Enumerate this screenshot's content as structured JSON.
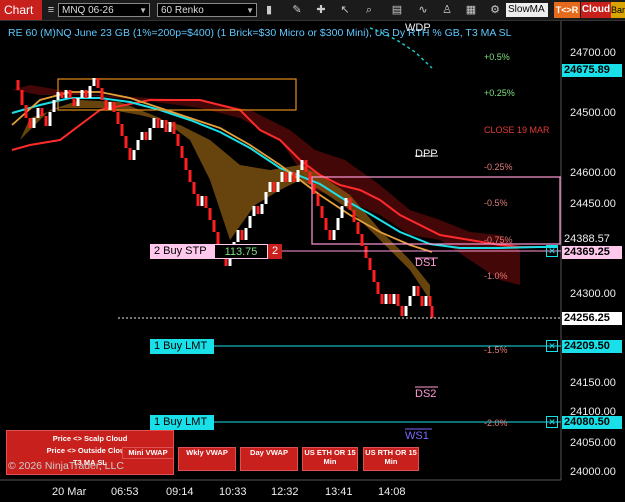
{
  "toolbar": {
    "chart_label": "Chart",
    "instrument": "MNQ 06-26",
    "bar_type": "60 Renko",
    "indicator_select": "SlowMA",
    "tcr_button": "T<>R",
    "cloud_button": "Cloud",
    "bar_button": "Bar"
  },
  "chart": {
    "title": "RE 60 (M)NQ June 23 GB (1%=200p=$400) (1 Brick=$30 Micro or $300 Mini), US Dy RTH % GB, T3 MA SL",
    "wdp_label": "WDP",
    "dpp_label": "DPP",
    "ds1_label": "DS1",
    "ds2_label": "DS2",
    "ws1_label": "WS1",
    "close_label": "CLOSE 19 MAR",
    "copyright": "© 2026 NinjaTrader, LLC",
    "percent_levels": {
      "p05": "+0.5%",
      "p025": "+0.25%",
      "m025": "-0.25%",
      "m05": "-0.5%",
      "m075": "-0.75%",
      "m10": "-1.0%",
      "m15": "-1.5%",
      "m20": "-2.0%"
    },
    "price_axis": [
      "24700.00",
      "24600.00",
      "24500.00",
      "24450.00",
      "24300.00",
      "24150.00",
      "24100.00",
      "24050.00",
      "24000.00"
    ],
    "price_boxes": {
      "top": "24675.89",
      "ma": "24388.57",
      "stop": "24369.25",
      "last": "24256.25",
      "lmt1": "24209.50",
      "lmt2": "24080.50"
    },
    "time_axis": [
      "20 Mar",
      "06:53",
      "09:14",
      "10:33",
      "12:32",
      "13:41",
      "14:08"
    ]
  },
  "orders": {
    "buy_stop_label": "2 Buy STP",
    "buy_stop_price": "113.75",
    "buy_stop_qty": "2",
    "buy_limit_1": "1 Buy LMT",
    "buy_limit_2": "1 Buy LMT",
    "close_x": "✕"
  },
  "buttons": {
    "scalp_cloud": "Price <> Scalp Cloud",
    "outside_clouds": "Price <> Outside Clouds",
    "t3_ma": "T3 MA SL",
    "mini_vwap": "Mini VWAP",
    "wkly_vwap": "Wkly VWAP",
    "day_vwap": "Day VWAP",
    "us_eth_or": "US ETH OR 15 Min",
    "us_rth_or": "US RTH OR 15 Min"
  },
  "colors": {
    "accent": "#c8201c",
    "cyan": "#19e0e8",
    "orange": "#e48a1c",
    "pink": "#ff9ad6"
  }
}
